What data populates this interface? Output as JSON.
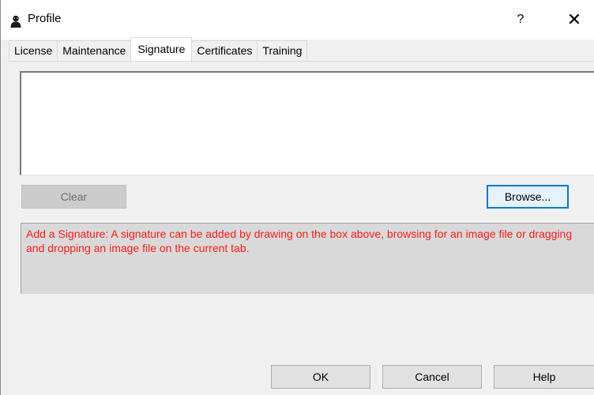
{
  "window": {
    "title": "Profile",
    "help_label": "?",
    "close_label": "✕"
  },
  "tabs": [
    {
      "label": "License",
      "active": false
    },
    {
      "label": "Maintenance",
      "active": false
    },
    {
      "label": "Signature",
      "active": true
    },
    {
      "label": "Certificates",
      "active": false
    },
    {
      "label": "Training",
      "active": false
    }
  ],
  "signature": {
    "clear_label": "Clear",
    "browse_label": "Browse...",
    "info_text": "Add a Signature: A signature can be added by drawing on the box above, browsing for an image file or dragging and dropping an image file on the current tab."
  },
  "footer": {
    "ok_label": "OK",
    "cancel_label": "Cancel",
    "help_label": "Help"
  },
  "colors": {
    "info_text": "#ff1a1a",
    "focus_border": "#0078d7"
  }
}
